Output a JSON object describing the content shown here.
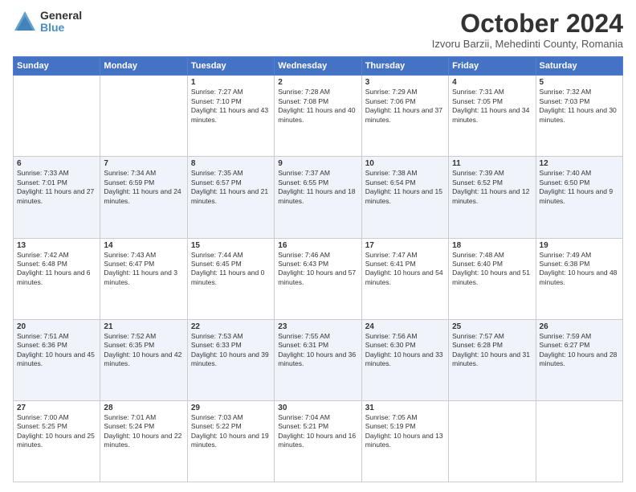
{
  "logo": {
    "general": "General",
    "blue": "Blue"
  },
  "header": {
    "month": "October 2024",
    "location": "Izvoru Barzii, Mehedinti County, Romania"
  },
  "weekdays": [
    "Sunday",
    "Monday",
    "Tuesday",
    "Wednesday",
    "Thursday",
    "Friday",
    "Saturday"
  ],
  "weeks": [
    [
      {
        "day": "",
        "sunrise": "",
        "sunset": "",
        "daylight": ""
      },
      {
        "day": "",
        "sunrise": "",
        "sunset": "",
        "daylight": ""
      },
      {
        "day": "1",
        "sunrise": "Sunrise: 7:27 AM",
        "sunset": "Sunset: 7:10 PM",
        "daylight": "Daylight: 11 hours and 43 minutes."
      },
      {
        "day": "2",
        "sunrise": "Sunrise: 7:28 AM",
        "sunset": "Sunset: 7:08 PM",
        "daylight": "Daylight: 11 hours and 40 minutes."
      },
      {
        "day": "3",
        "sunrise": "Sunrise: 7:29 AM",
        "sunset": "Sunset: 7:06 PM",
        "daylight": "Daylight: 11 hours and 37 minutes."
      },
      {
        "day": "4",
        "sunrise": "Sunrise: 7:31 AM",
        "sunset": "Sunset: 7:05 PM",
        "daylight": "Daylight: 11 hours and 34 minutes."
      },
      {
        "day": "5",
        "sunrise": "Sunrise: 7:32 AM",
        "sunset": "Sunset: 7:03 PM",
        "daylight": "Daylight: 11 hours and 30 minutes."
      }
    ],
    [
      {
        "day": "6",
        "sunrise": "Sunrise: 7:33 AM",
        "sunset": "Sunset: 7:01 PM",
        "daylight": "Daylight: 11 hours and 27 minutes."
      },
      {
        "day": "7",
        "sunrise": "Sunrise: 7:34 AM",
        "sunset": "Sunset: 6:59 PM",
        "daylight": "Daylight: 11 hours and 24 minutes."
      },
      {
        "day": "8",
        "sunrise": "Sunrise: 7:35 AM",
        "sunset": "Sunset: 6:57 PM",
        "daylight": "Daylight: 11 hours and 21 minutes."
      },
      {
        "day": "9",
        "sunrise": "Sunrise: 7:37 AM",
        "sunset": "Sunset: 6:55 PM",
        "daylight": "Daylight: 11 hours and 18 minutes."
      },
      {
        "day": "10",
        "sunrise": "Sunrise: 7:38 AM",
        "sunset": "Sunset: 6:54 PM",
        "daylight": "Daylight: 11 hours and 15 minutes."
      },
      {
        "day": "11",
        "sunrise": "Sunrise: 7:39 AM",
        "sunset": "Sunset: 6:52 PM",
        "daylight": "Daylight: 11 hours and 12 minutes."
      },
      {
        "day": "12",
        "sunrise": "Sunrise: 7:40 AM",
        "sunset": "Sunset: 6:50 PM",
        "daylight": "Daylight: 11 hours and 9 minutes."
      }
    ],
    [
      {
        "day": "13",
        "sunrise": "Sunrise: 7:42 AM",
        "sunset": "Sunset: 6:48 PM",
        "daylight": "Daylight: 11 hours and 6 minutes."
      },
      {
        "day": "14",
        "sunrise": "Sunrise: 7:43 AM",
        "sunset": "Sunset: 6:47 PM",
        "daylight": "Daylight: 11 hours and 3 minutes."
      },
      {
        "day": "15",
        "sunrise": "Sunrise: 7:44 AM",
        "sunset": "Sunset: 6:45 PM",
        "daylight": "Daylight: 11 hours and 0 minutes."
      },
      {
        "day": "16",
        "sunrise": "Sunrise: 7:46 AM",
        "sunset": "Sunset: 6:43 PM",
        "daylight": "Daylight: 10 hours and 57 minutes."
      },
      {
        "day": "17",
        "sunrise": "Sunrise: 7:47 AM",
        "sunset": "Sunset: 6:41 PM",
        "daylight": "Daylight: 10 hours and 54 minutes."
      },
      {
        "day": "18",
        "sunrise": "Sunrise: 7:48 AM",
        "sunset": "Sunset: 6:40 PM",
        "daylight": "Daylight: 10 hours and 51 minutes."
      },
      {
        "day": "19",
        "sunrise": "Sunrise: 7:49 AM",
        "sunset": "Sunset: 6:38 PM",
        "daylight": "Daylight: 10 hours and 48 minutes."
      }
    ],
    [
      {
        "day": "20",
        "sunrise": "Sunrise: 7:51 AM",
        "sunset": "Sunset: 6:36 PM",
        "daylight": "Daylight: 10 hours and 45 minutes."
      },
      {
        "day": "21",
        "sunrise": "Sunrise: 7:52 AM",
        "sunset": "Sunset: 6:35 PM",
        "daylight": "Daylight: 10 hours and 42 minutes."
      },
      {
        "day": "22",
        "sunrise": "Sunrise: 7:53 AM",
        "sunset": "Sunset: 6:33 PM",
        "daylight": "Daylight: 10 hours and 39 minutes."
      },
      {
        "day": "23",
        "sunrise": "Sunrise: 7:55 AM",
        "sunset": "Sunset: 6:31 PM",
        "daylight": "Daylight: 10 hours and 36 minutes."
      },
      {
        "day": "24",
        "sunrise": "Sunrise: 7:56 AM",
        "sunset": "Sunset: 6:30 PM",
        "daylight": "Daylight: 10 hours and 33 minutes."
      },
      {
        "day": "25",
        "sunrise": "Sunrise: 7:57 AM",
        "sunset": "Sunset: 6:28 PM",
        "daylight": "Daylight: 10 hours and 31 minutes."
      },
      {
        "day": "26",
        "sunrise": "Sunrise: 7:59 AM",
        "sunset": "Sunset: 6:27 PM",
        "daylight": "Daylight: 10 hours and 28 minutes."
      }
    ],
    [
      {
        "day": "27",
        "sunrise": "Sunrise: 7:00 AM",
        "sunset": "Sunset: 5:25 PM",
        "daylight": "Daylight: 10 hours and 25 minutes."
      },
      {
        "day": "28",
        "sunrise": "Sunrise: 7:01 AM",
        "sunset": "Sunset: 5:24 PM",
        "daylight": "Daylight: 10 hours and 22 minutes."
      },
      {
        "day": "29",
        "sunrise": "Sunrise: 7:03 AM",
        "sunset": "Sunset: 5:22 PM",
        "daylight": "Daylight: 10 hours and 19 minutes."
      },
      {
        "day": "30",
        "sunrise": "Sunrise: 7:04 AM",
        "sunset": "Sunset: 5:21 PM",
        "daylight": "Daylight: 10 hours and 16 minutes."
      },
      {
        "day": "31",
        "sunrise": "Sunrise: 7:05 AM",
        "sunset": "Sunset: 5:19 PM",
        "daylight": "Daylight: 10 hours and 13 minutes."
      },
      {
        "day": "",
        "sunrise": "",
        "sunset": "",
        "daylight": ""
      },
      {
        "day": "",
        "sunrise": "",
        "sunset": "",
        "daylight": ""
      }
    ]
  ]
}
